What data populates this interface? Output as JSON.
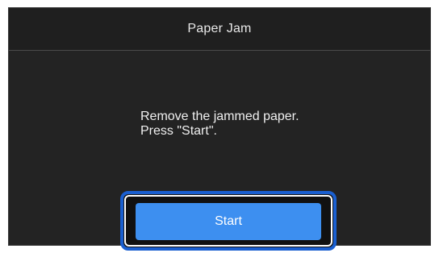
{
  "dialog": {
    "title": "Paper Jam",
    "message_lines": [
      "Remove the jammed paper.",
      "Press \"Start\"."
    ],
    "start_button_label": "Start"
  },
  "colors": {
    "screen_background": "#232323",
    "button_background": "#3d8ff0",
    "highlight_outline": "#1a5fd0"
  }
}
